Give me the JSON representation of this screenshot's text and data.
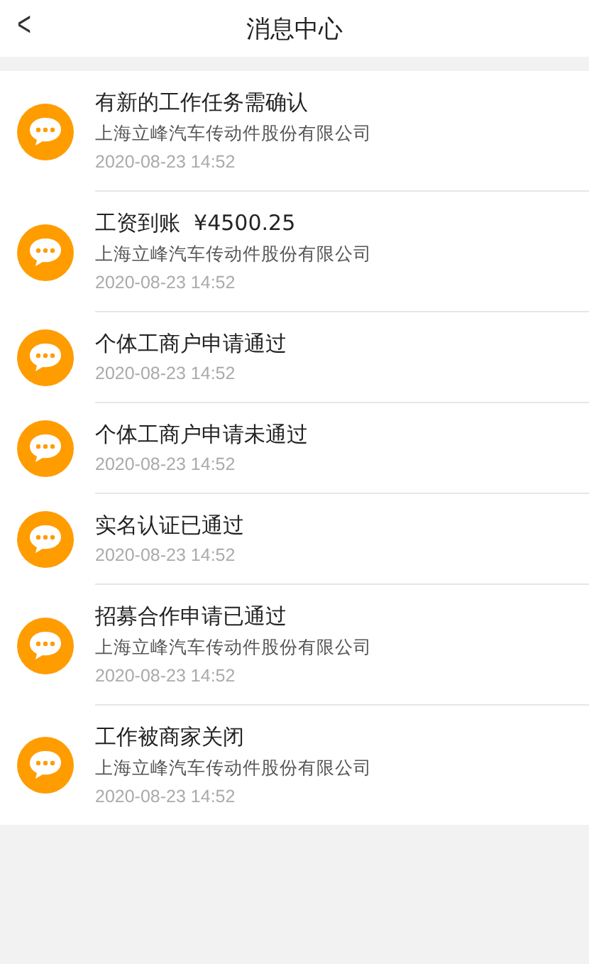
{
  "header": {
    "back": "<",
    "title": "消息中心"
  },
  "messages": [
    {
      "title": "有新的工作任务需确认",
      "company": "上海立峰汽车传动件股份有限公司",
      "time": "2020-08-23 14:52"
    },
    {
      "title": "工资到账  ¥4500.25",
      "company": "上海立峰汽车传动件股份有限公司",
      "time": "2020-08-23 14:52"
    },
    {
      "title": "个体工商户申请通过",
      "time": "2020-08-23 14:52"
    },
    {
      "title": "个体工商户申请未通过",
      "time": "2020-08-23 14:52"
    },
    {
      "title": "实名认证已通过",
      "time": "2020-08-23 14:52"
    },
    {
      "title": "招募合作申请已通过",
      "company": "上海立峰汽车传动件股份有限公司",
      "time": "2020-08-23 14:52"
    },
    {
      "title": "工作被商家关闭",
      "company": "上海立峰汽车传动件股份有限公司",
      "time": "2020-08-23 14:52"
    }
  ]
}
